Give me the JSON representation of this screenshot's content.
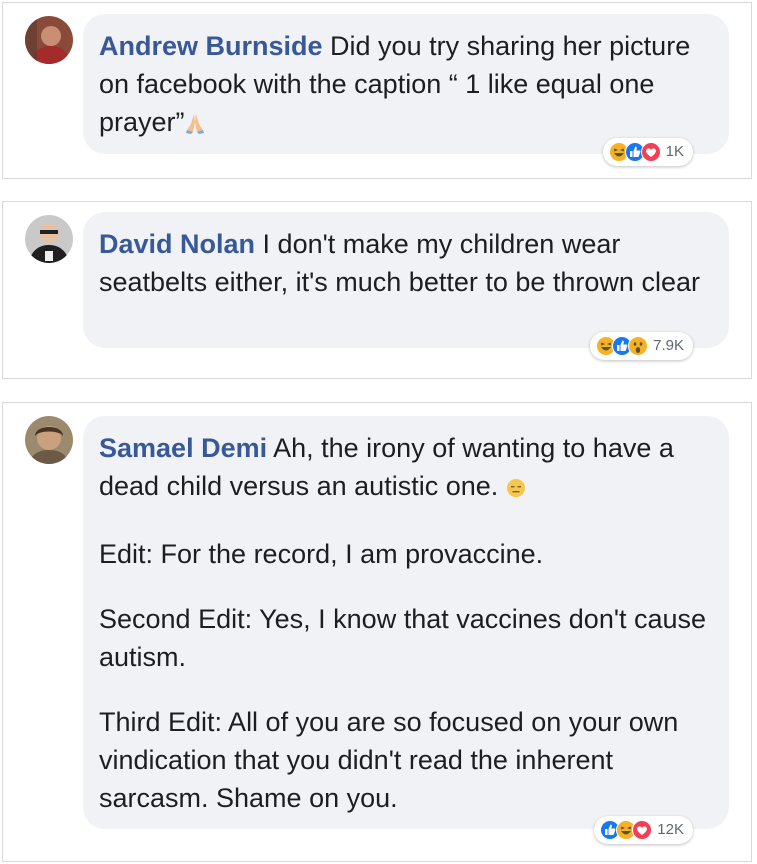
{
  "comments": [
    {
      "author": "Andrew Burnside",
      "paragraphs": [
        "Did you try sharing her picture on facebook with the caption “ 1 like equal one prayer”"
      ],
      "trailing_emoji": "praying-hands",
      "reactions": {
        "icons": [
          "haha",
          "like",
          "love"
        ],
        "count": "1K"
      }
    },
    {
      "author": "David Nolan",
      "paragraphs": [
        "I don't make my children wear seatbelts either, it's much better to be thrown clear"
      ],
      "reactions": {
        "icons": [
          "haha",
          "like",
          "wow"
        ],
        "count": "7.9K"
      }
    },
    {
      "author": "Samael Demi",
      "paragraphs": [
        "Ah, the irony of wanting to have a dead child versus an autistic one.",
        "Edit: For the record, I am provaccine.",
        "Second Edit: Yes, I know that vaccines don't cause autism.",
        "Third Edit: All of you are so focused on your own vindication that you didn't read the inherent sarcasm. Shame on you."
      ],
      "trailing_emoji": "expressionless-face",
      "reactions": {
        "icons": [
          "like",
          "haha",
          "love"
        ],
        "count": "12K"
      }
    }
  ],
  "colors": {
    "author_name": "#385898",
    "bubble_bg": "#f0f2f5",
    "like_blue": "#1877f2",
    "love_red": "#f33e58",
    "haha_yellow": "#f7b125"
  }
}
